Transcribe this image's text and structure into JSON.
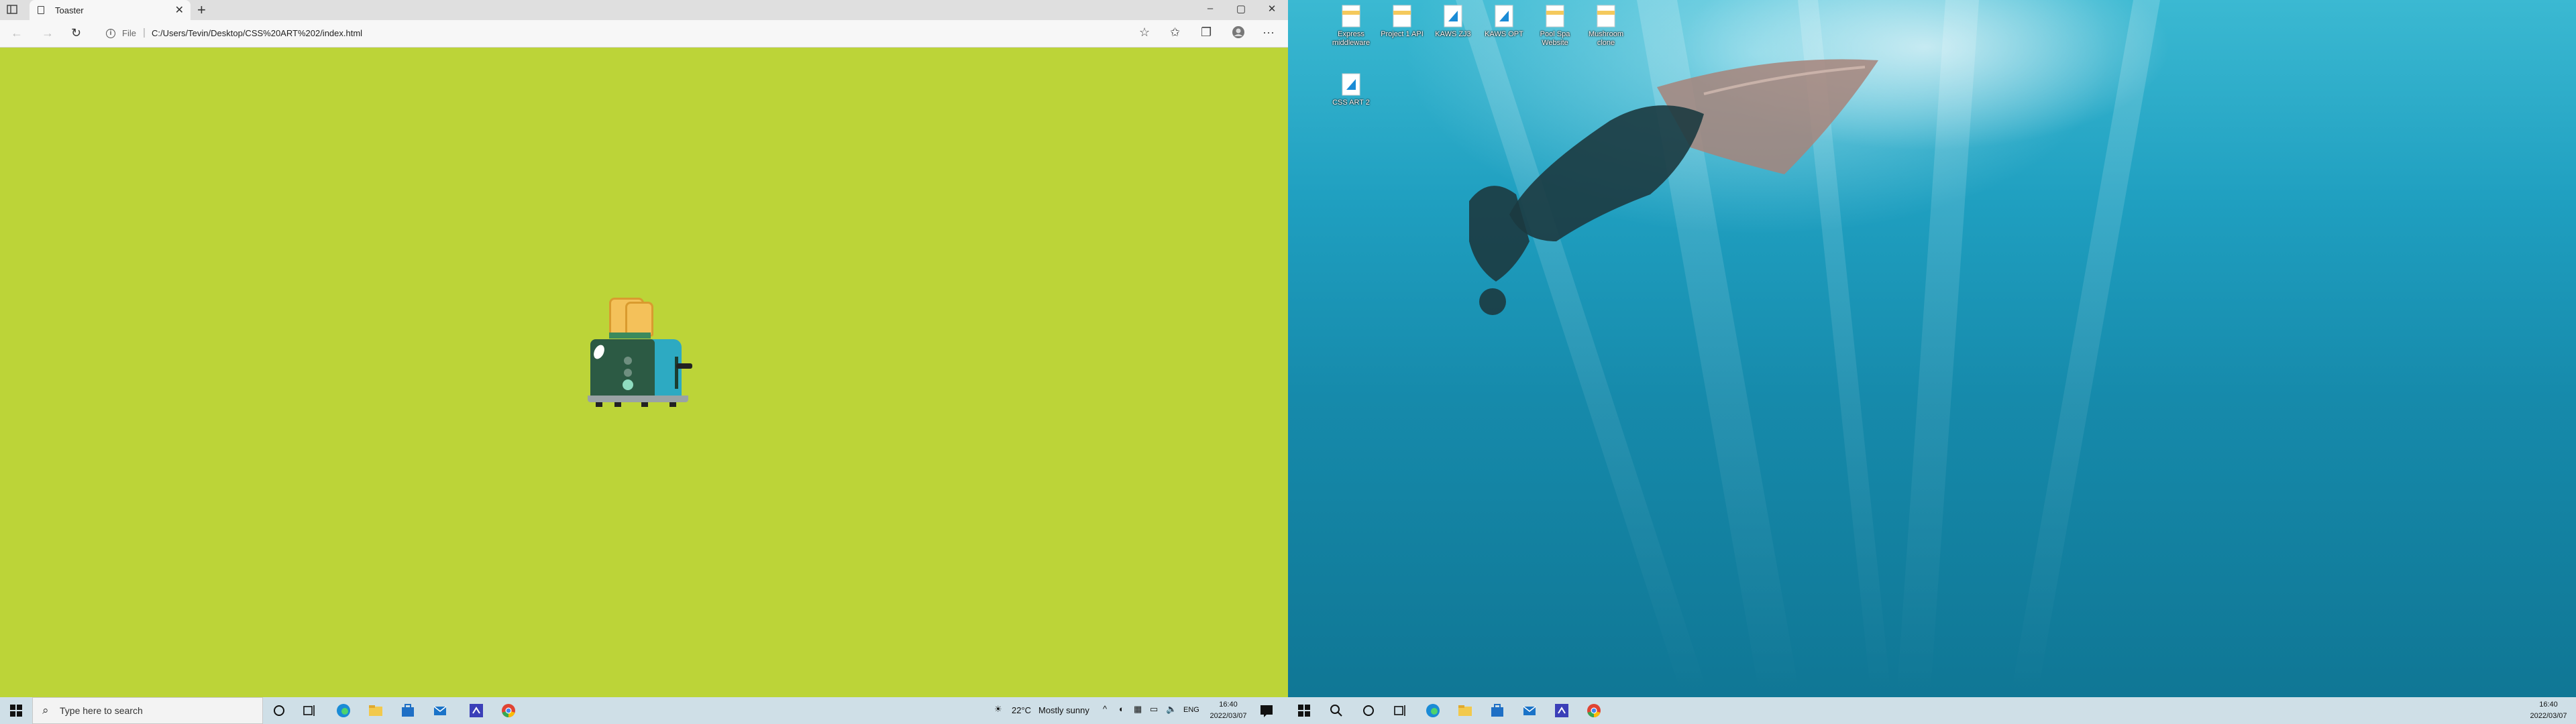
{
  "browser": {
    "tab_title": "Toaster",
    "new_tab_symbol": "+",
    "close_symbol": "✕",
    "url_scheme_label": "File",
    "url": "C:/Users/Tevin/Desktop/CSS%20ART%202/index.html",
    "window_controls": [
      "–",
      "▢",
      "✕"
    ],
    "page_background": "#bcd438"
  },
  "left_taskbar": {
    "search_placeholder": "Type here to search",
    "weather_temp": "22°C",
    "weather_desc": "Mostly sunny",
    "language": "ENG",
    "time": "16:40",
    "date": "2022/03/07",
    "pinned_apps": [
      "edge-icon",
      "file-explorer-icon",
      "store-icon",
      "mail-icon",
      "code-icon",
      "chrome-icon"
    ]
  },
  "desktop": {
    "icons": [
      {
        "label": "Express middleware"
      },
      {
        "label": "Project 1 API"
      },
      {
        "label": "KAWS ZJ3"
      },
      {
        "label": "KAWS OPT"
      },
      {
        "label": "Pool Spa Website"
      },
      {
        "label": "Mushroom clone"
      },
      {
        "label": "CSS ART 2"
      }
    ]
  },
  "right_taskbar": {
    "time": "16:40",
    "date": "2022/03/07",
    "pinned_apps": [
      "edge-icon",
      "file-explorer-icon",
      "store-icon",
      "mail-icon",
      "code-icon",
      "chrome-icon"
    ]
  },
  "colors": {
    "toaster_dark": "#2c5a44",
    "toaster_light": "#2daac2",
    "bread": "#f4c15a",
    "bread_crust": "#d99b2f"
  }
}
